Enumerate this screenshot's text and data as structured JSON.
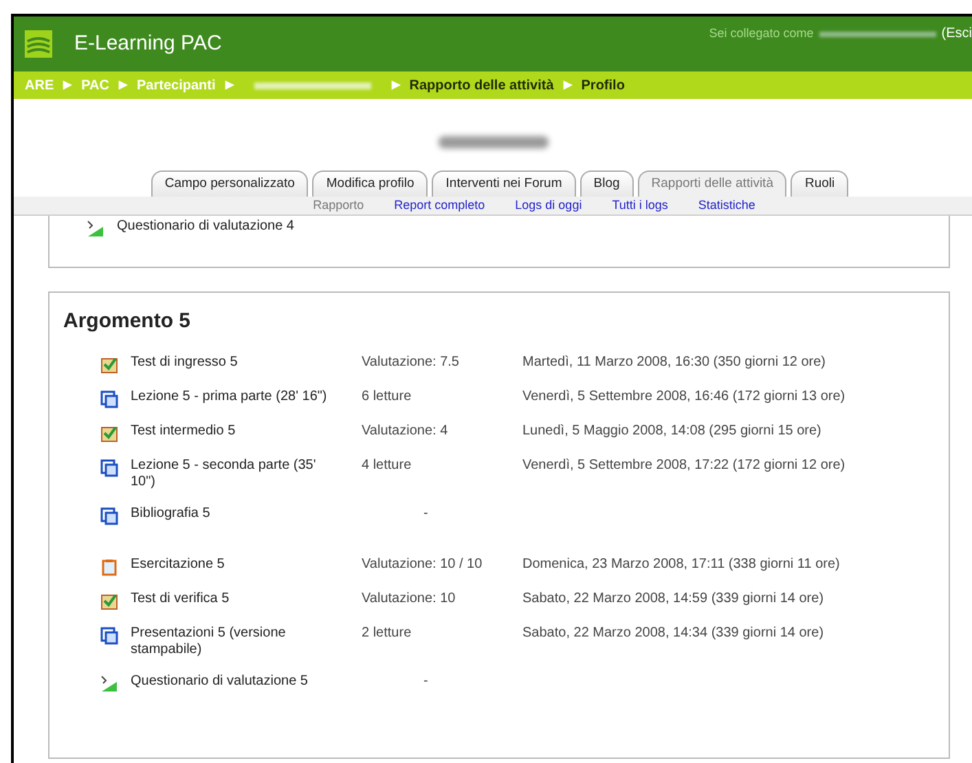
{
  "header": {
    "site_title": "E-Learning PAC",
    "login_text": "Sei collegato come",
    "logout_text": "(Esci"
  },
  "breadcrumb": [
    {
      "kind": "link",
      "label": "ARE",
      "current": false
    },
    {
      "kind": "separator",
      "label": "▶"
    },
    {
      "kind": "link",
      "label": "PAC",
      "current": false
    },
    {
      "kind": "separator",
      "label": "▶"
    },
    {
      "kind": "link",
      "label": "Partecipanti",
      "current": false
    },
    {
      "kind": "separator",
      "label": "▶"
    },
    {
      "kind": "redacted"
    },
    {
      "kind": "separator",
      "label": "▶"
    },
    {
      "kind": "link",
      "label": "Rapporto delle attività",
      "current": true
    },
    {
      "kind": "separator",
      "label": "▶"
    },
    {
      "kind": "link",
      "label": "Profilo",
      "current": true
    }
  ],
  "tabs": [
    {
      "label": "Campo personalizzato",
      "selected": false
    },
    {
      "label": "Modifica profilo",
      "selected": false
    },
    {
      "label": "Interventi nei Forum",
      "selected": false
    },
    {
      "label": "Blog",
      "selected": false
    },
    {
      "label": "Rapporti delle attività",
      "selected": true
    },
    {
      "label": "Ruoli",
      "selected": false
    }
  ],
  "subtabs": [
    {
      "label": "Rapporto",
      "selected": true
    },
    {
      "label": "Report completo",
      "selected": false
    },
    {
      "label": "Logs di oggi",
      "selected": false
    },
    {
      "label": "Tutti i logs",
      "selected": false
    },
    {
      "label": "Statistiche",
      "selected": false
    }
  ],
  "previous_section": {
    "rows": [
      {
        "kind": "feedback",
        "name": "Questionario di valutazione 4"
      }
    ]
  },
  "section": {
    "title": "Argomento 5",
    "rows": [
      {
        "kind": "quiz",
        "name": "Test di ingresso 5",
        "info": "Valutazione: 7.5",
        "date": "Martedì, 11 Marzo 2008, 16:30 (350 giorni 12 ore)"
      },
      {
        "kind": "resource",
        "name": "Lezione 5 - prima parte (28' 16\")",
        "info": "6 letture",
        "date": "Venerdì, 5 Settembre 2008, 16:46 (172 giorni 13 ore)"
      },
      {
        "kind": "quiz",
        "name": "Test intermedio 5",
        "info": "Valutazione: 4",
        "date": "Lunedì, 5 Maggio 2008, 14:08 (295 giorni 15 ore)"
      },
      {
        "kind": "resource",
        "name": "Lezione 5 - seconda parte (35' 10\")",
        "info": "4 letture",
        "date": "Venerdì, 5 Settembre 2008, 17:22 (172 giorni 12 ore)"
      },
      {
        "kind": "resource",
        "name": "Bibliografia 5",
        "info": "-"
      },
      {
        "kind": "assignment",
        "name": "Esercitazione 5",
        "info": "Valutazione: 10 / 10",
        "date": "Domenica, 23 Marzo 2008, 17:11 (338 giorni 11 ore)"
      },
      {
        "kind": "quiz",
        "name": "Test di verifica 5",
        "info": "Valutazione: 10",
        "date": "Sabato, 22 Marzo 2008, 14:59 (339 giorni 14 ore)"
      },
      {
        "kind": "resource",
        "name": "Presentazioni 5 (versione stampabile)",
        "info": "2 letture",
        "date": "Sabato, 22 Marzo 2008, 14:34 (339 giorni 14 ore)"
      },
      {
        "kind": "feedback",
        "name": "Questionario di valutazione 5",
        "info": "-"
      }
    ]
  }
}
